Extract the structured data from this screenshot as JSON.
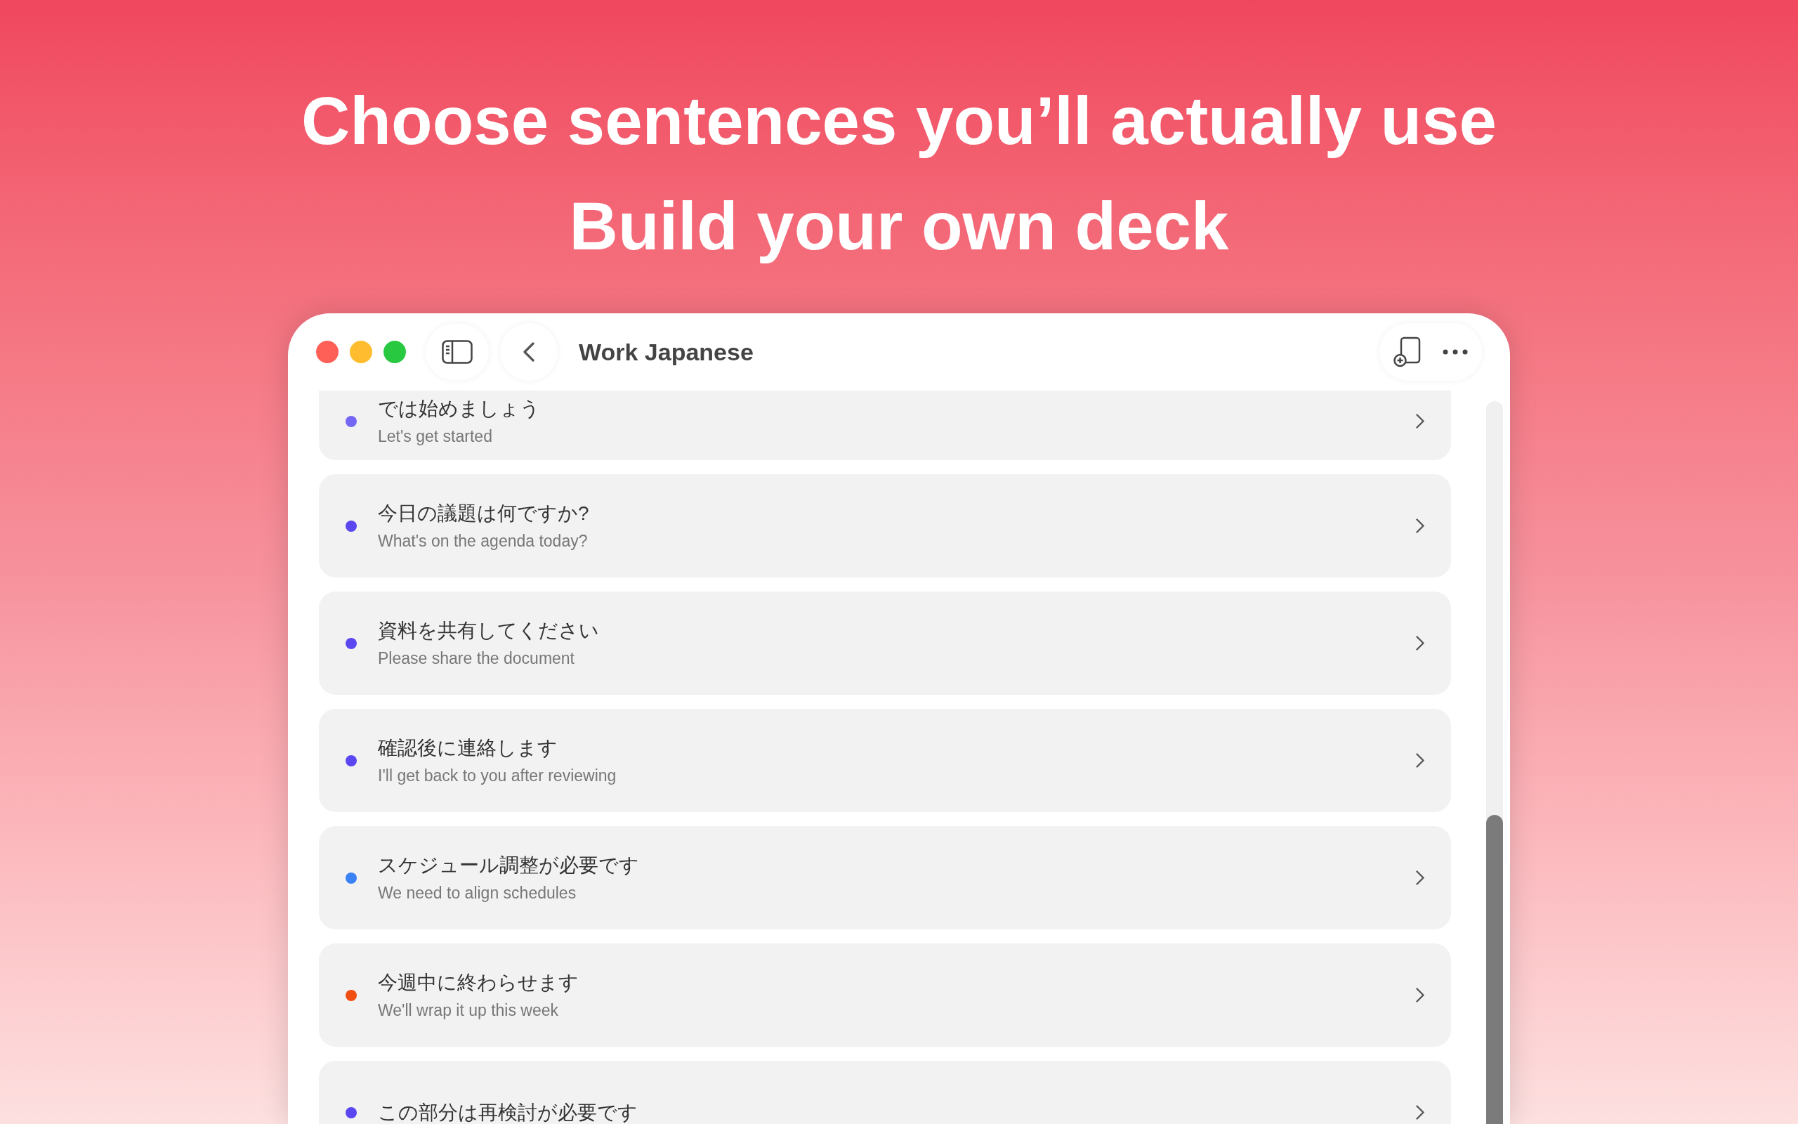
{
  "headline": [
    "Choose sentences you’ll actually use",
    "Build your own deck"
  ],
  "window": {
    "title": "Work Japanese"
  },
  "phrases": [
    {
      "japanese": "では始めましょう",
      "english": "Let's get started",
      "color": "#7567f5"
    },
    {
      "japanese": "今日の議題は何ですか?",
      "english": "What's on the agenda today?",
      "color": "#5b47f0"
    },
    {
      "japanese": "資料を共有してください",
      "english": "Please share the document",
      "color": "#5b47f0"
    },
    {
      "japanese": "確認後に連絡します",
      "english": "I'll get back to you after reviewing",
      "color": "#5b47f0"
    },
    {
      "japanese": "スケジュール調整が必要です",
      "english": "We need to align schedules",
      "color": "#3b82f6"
    },
    {
      "japanese": "今週中に終わらせます",
      "english": "We'll wrap it up this week",
      "color": "#f04e12"
    },
    {
      "japanese": "この部分は再検討が必要です",
      "color": "#5b47f0"
    }
  ]
}
